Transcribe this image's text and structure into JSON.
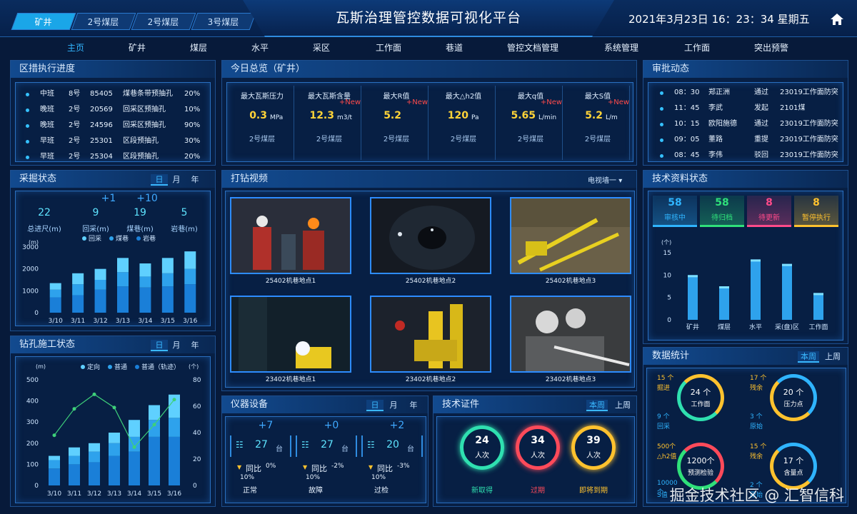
{
  "header": {
    "tabs": [
      "矿井",
      "2号煤层",
      "2号煤层",
      "3号煤层"
    ],
    "title": "瓦斯治理管控数据可视化平台",
    "datetime": "2021年3月23日  16：23：34  星期五"
  },
  "nav": [
    "主页",
    "矿井",
    "煤层",
    "水平",
    "采区",
    "工作面",
    "巷道",
    "管控文档管理",
    "系统管理",
    "工作面",
    "突出预警"
  ],
  "quzuo": {
    "title": "区措执行进度",
    "rows": [
      [
        "中班",
        "8号",
        "85405",
        "煤巷条带预抽孔",
        "20%"
      ],
      [
        "晚班",
        "2号",
        "20569",
        "回采区预抽孔",
        "10%"
      ],
      [
        "晚班",
        "2号",
        "24596",
        "回采区预抽孔",
        "90%"
      ],
      [
        "早班",
        "2号",
        "25301",
        "区段预抽孔",
        "30%"
      ],
      [
        "早班",
        "2号",
        "25304",
        "区段预抽孔",
        "20%"
      ]
    ]
  },
  "caijue": {
    "title": "采掘状态",
    "periods": [
      "日",
      "月",
      "年"
    ],
    "plus": [
      "+1",
      "+10"
    ],
    "stats": [
      {
        "v": "22",
        "l": "总进尺(m)"
      },
      {
        "v": "9",
        "l": "回采(m)"
      },
      {
        "v": "19",
        "l": "煤巷(m)"
      },
      {
        "v": "5",
        "l": "岩巷(m)"
      }
    ],
    "legend": [
      "回采",
      "煤巷",
      "岩巷"
    ],
    "unit": "(m)"
  },
  "zuankong": {
    "title": "钻孔施工状态",
    "periods": [
      "日",
      "月",
      "年"
    ],
    "legend": [
      "定向",
      "普通",
      "普通（轨迹）"
    ],
    "unit_l": "(m)",
    "unit_r": "(个)"
  },
  "overview": {
    "title": "今日总览（矿井）",
    "items": [
      {
        "name": "最大瓦斯压力",
        "val": "0.3",
        "unit": "MPa",
        "sub": "2号煤层",
        "tag": ""
      },
      {
        "name": "最大瓦斯含量",
        "val": "12.3",
        "unit": "m3/t",
        "sub": "2号煤层",
        "tag": "+New"
      },
      {
        "name": "最大R值",
        "val": "5.2",
        "unit": "",
        "sub": "2号煤层",
        "tag": "+New"
      },
      {
        "name": "最大△h2值",
        "val": "120",
        "unit": "Pa",
        "sub": "2号煤层",
        "tag": ""
      },
      {
        "name": "最大q值",
        "val": "5.65",
        "unit": "L/min",
        "sub": "2号煤层",
        "tag": "+New"
      },
      {
        "name": "最大S值",
        "val": "5.2",
        "unit": "L/m",
        "sub": "2号煤层",
        "tag": "+New"
      }
    ]
  },
  "video": {
    "title": "打钻视频",
    "select": "电视墙一",
    "captions": [
      "25402机巷地点1",
      "25402机巷地点2",
      "25402机巷地点3",
      "23402机巷地点1",
      "23402机巷地点2",
      "23402机巷地点3"
    ]
  },
  "yiqi": {
    "title": "仪器设备",
    "periods": [
      "日",
      "月",
      "年"
    ],
    "items": [
      {
        "plus": "+7",
        "v": "27",
        "u": "台",
        "pct": "0%",
        "pct2": "10%",
        "name": "正常"
      },
      {
        "plus": "+0",
        "v": "27",
        "u": "台",
        "pct": "-2%",
        "pct2": "10%",
        "name": "故障"
      },
      {
        "plus": "+2",
        "v": "20",
        "u": "台",
        "pct": "-3%",
        "pct2": "10%",
        "name": "过检"
      }
    ],
    "ratio": "同比"
  },
  "zhengjian": {
    "title": "技术证件",
    "periods": [
      "本周",
      "上周"
    ],
    "items": [
      {
        "v": "24",
        "u": "人次",
        "name": "新取得",
        "color": "#2fe0b0"
      },
      {
        "v": "34",
        "u": "人次",
        "name": "过期",
        "color": "#ff4a5a"
      },
      {
        "v": "39",
        "u": "人次",
        "name": "即将到期",
        "color": "#ffc22e"
      }
    ]
  },
  "shenpi": {
    "title": "审批动态",
    "rows": [
      [
        "08：30",
        "郑正洲",
        "通过",
        "23019工作面防突"
      ],
      [
        "11：45",
        "李武",
        "发起",
        "2101煤"
      ],
      [
        "10：15",
        "欧阳施德",
        "通过",
        "23019工作面防突"
      ],
      [
        "09：05",
        "董路",
        "重提",
        "23019工作面防突"
      ],
      [
        "08：45",
        "李伟",
        "驳回",
        "23019工作面防突"
      ]
    ]
  },
  "jishu": {
    "title": "技术资料状态",
    "badges": [
      {
        "v": "58",
        "l": "审核中",
        "c": "#2fb4ff"
      },
      {
        "v": "58",
        "l": "待归档",
        "c": "#2fe07a"
      },
      {
        "v": "8",
        "l": "待更新",
        "c": "#ff4a8a"
      },
      {
        "v": "8",
        "l": "暂停执行",
        "c": "#ffc22e"
      }
    ],
    "unit": "(个)"
  },
  "shuju": {
    "title": "数据统计",
    "periods": [
      "本周",
      "上周"
    ],
    "c1": {
      "center": "24 个",
      "label": "工作面",
      "a": "15 个",
      "al": "掘进",
      "b": "9 个",
      "bl": "回采"
    },
    "c2": {
      "center": "20 个",
      "label": "压力点",
      "a": "17 个",
      "al": "残余",
      "b": "3 个",
      "bl": "原始"
    },
    "c3": {
      "center": "1200个",
      "label": "预测检验",
      "a": "500个",
      "al": "△h2值",
      "b": "10000个",
      "bl": "S值"
    },
    "c4": {
      "center": "17 个",
      "label": "含量点",
      "a": "15 个",
      "al": "残余",
      "b": "2 个",
      "bl": "原始"
    }
  },
  "watermark": "掘金技术社区 @ 汇智信科",
  "chart_data": [
    {
      "type": "bar",
      "title": "采掘状态",
      "categories": [
        "3/10",
        "3/11",
        "3/12",
        "3/13",
        "3/14",
        "3/15",
        "3/16"
      ],
      "ylim": [
        0,
        3000
      ],
      "yticks": [
        0,
        1000,
        2000,
        3000
      ],
      "series": [
        {
          "name": "回采",
          "values": [
            700,
            800,
            1050,
            1200,
            1150,
            1200,
            1300
          ]
        },
        {
          "name": "煤巷",
          "values": [
            350,
            500,
            450,
            650,
            500,
            600,
            700
          ]
        },
        {
          "name": "岩巷",
          "values": [
            300,
            500,
            500,
            650,
            600,
            700,
            800
          ]
        }
      ]
    },
    {
      "type": "bar",
      "title": "钻孔施工状态",
      "categories": [
        "3/10",
        "3/11",
        "3/12",
        "3/13",
        "3/14",
        "3/15",
        "3/16"
      ],
      "ylim": [
        0,
        500
      ],
      "yticks": [
        0,
        100,
        200,
        300,
        400,
        500
      ],
      "y2lim": [
        0,
        80
      ],
      "y2ticks": [
        0,
        20,
        40,
        60,
        80
      ],
      "series": [
        {
          "name": "定向",
          "values": [
            80,
            100,
            110,
            140,
            160,
            230,
            230
          ]
        },
        {
          "name": "普通",
          "values": [
            40,
            40,
            50,
            60,
            70,
            80,
            90
          ]
        },
        {
          "name": "普通（轨迹）",
          "values": [
            20,
            40,
            40,
            50,
            80,
            70,
            110
          ]
        }
      ],
      "line": {
        "name": "line",
        "values": [
          38,
          58,
          69,
          59,
          29,
          46,
          65
        ]
      }
    },
    {
      "type": "bar",
      "title": "技术资料状态",
      "categories": [
        "矿井",
        "煤层",
        "水平",
        "采(盘)区",
        "工作面"
      ],
      "ylim": [
        0,
        15
      ],
      "yticks": [
        0,
        5,
        10,
        15
      ],
      "values": [
        10,
        7.5,
        13.5,
        12.5,
        6
      ]
    }
  ]
}
